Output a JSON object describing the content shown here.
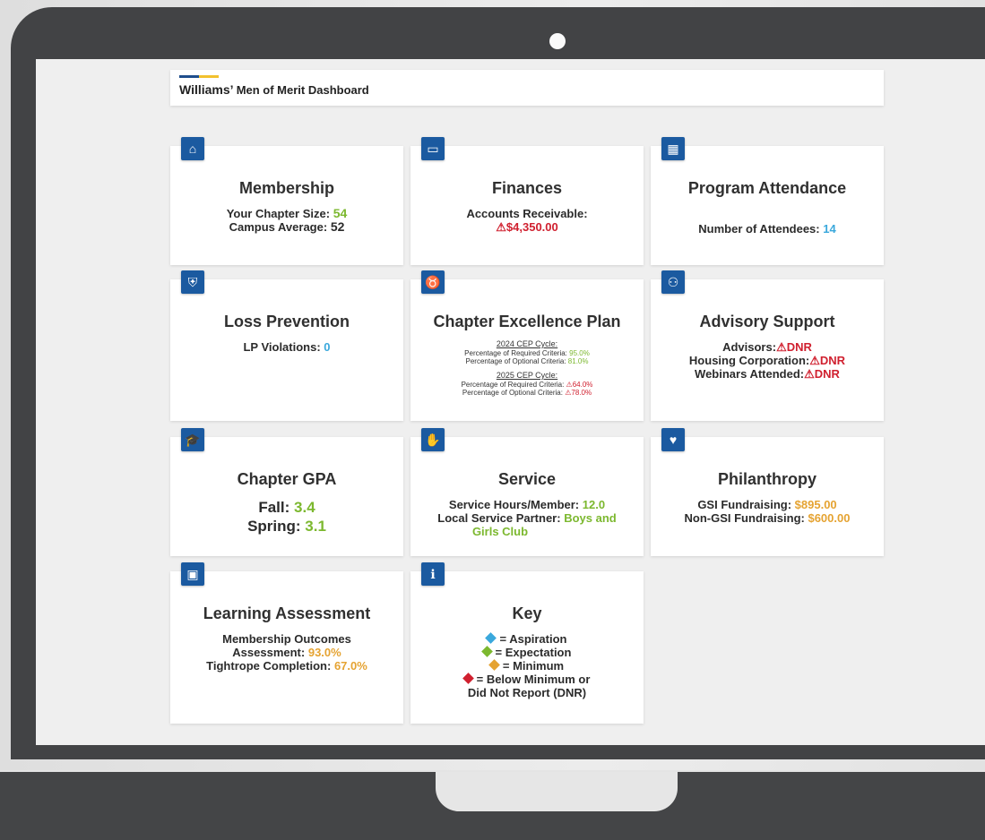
{
  "header": {
    "title_main": "Williams’",
    "title_sub": "Men of Merit Dashboard"
  },
  "icons": {
    "warning": "⚠"
  },
  "colors": {
    "accent": "#1b5aa0",
    "aspiration": "#3aa8dc",
    "expectation": "#7cb82f",
    "minimum": "#e5a332",
    "below": "#d0202f"
  },
  "cards": {
    "membership": {
      "icon": "home-icon",
      "title": "Membership",
      "chapter_size_label": "Your Chapter Size:",
      "chapter_size": "54",
      "campus_avg_label": "Campus Average:",
      "campus_avg": "52"
    },
    "finances": {
      "icon": "money-icon",
      "title": "Finances",
      "ar_label": "Accounts Receivable:",
      "ar_value": "$4,350.00"
    },
    "attendance": {
      "icon": "calendar-icon",
      "title": "Program Attendance",
      "attendees_label": "Number of Attendees:",
      "attendees": "14"
    },
    "loss_prevention": {
      "icon": "shield-icon",
      "title": "Loss Prevention",
      "violations_label": "LP Violations:",
      "violations": "0"
    },
    "cep": {
      "icon": "medal-icon",
      "title": "Chapter Excellence Plan",
      "c2024_label": "2024 CEP Cycle:",
      "c2024_req_label": "Percentage of Required Criteria:",
      "c2024_req": "95.0%",
      "c2024_opt_label": "Percentage of Optional Criteria:",
      "c2024_opt": "81.0%",
      "c2025_label": "2025 CEP Cycle:",
      "c2025_req_label": "Percentage of Required Criteria:",
      "c2025_req": "64.0%",
      "c2025_opt_label": "Percentage of Optional Criteria:",
      "c2025_opt": "78.0%"
    },
    "advisory": {
      "icon": "people-icon",
      "title": "Advisory Support",
      "advisors_label": "Advisors:",
      "advisors": "DNR",
      "housing_label": "Housing Corporation:",
      "housing": "DNR",
      "webinars_label": "Webinars Attended:",
      "webinars": "DNR"
    },
    "gpa": {
      "icon": "graduation-cap-icon",
      "title": "Chapter GPA",
      "fall_label": "Fall:",
      "fall": "3.4",
      "spring_label": "Spring:",
      "spring": "3.1"
    },
    "service": {
      "icon": "handshake-icon",
      "title": "Service",
      "hours_label": "Service Hours/Member:",
      "hours": "12.0",
      "partner_label": "Local Service Partner:",
      "partner_a": "Boys and",
      "partner_b": "Girls Club"
    },
    "philanthropy": {
      "icon": "hand-heart-icon",
      "title": "Philanthropy",
      "gsi_label": "GSI Fundraising:",
      "gsi": "$895.00",
      "nongsi_label": "Non-GSI Fundraising:",
      "nongsi": "$600.00"
    },
    "learning": {
      "icon": "chart-screen-icon",
      "title": "Learning Assessment",
      "mo_label_a": "Membership Outcomes",
      "mo_label_b": "Assessment:",
      "mo": "93.0%",
      "tight_label": "Tightrope Completion:",
      "tight": "67.0%"
    },
    "key": {
      "icon": "info-icon",
      "title": "Key",
      "aspiration": "= Aspiration",
      "expectation": "= Expectation",
      "minimum": "= Minimum",
      "below_a": "= Below Minimum or",
      "below_b": "Did Not Report (DNR)"
    }
  }
}
